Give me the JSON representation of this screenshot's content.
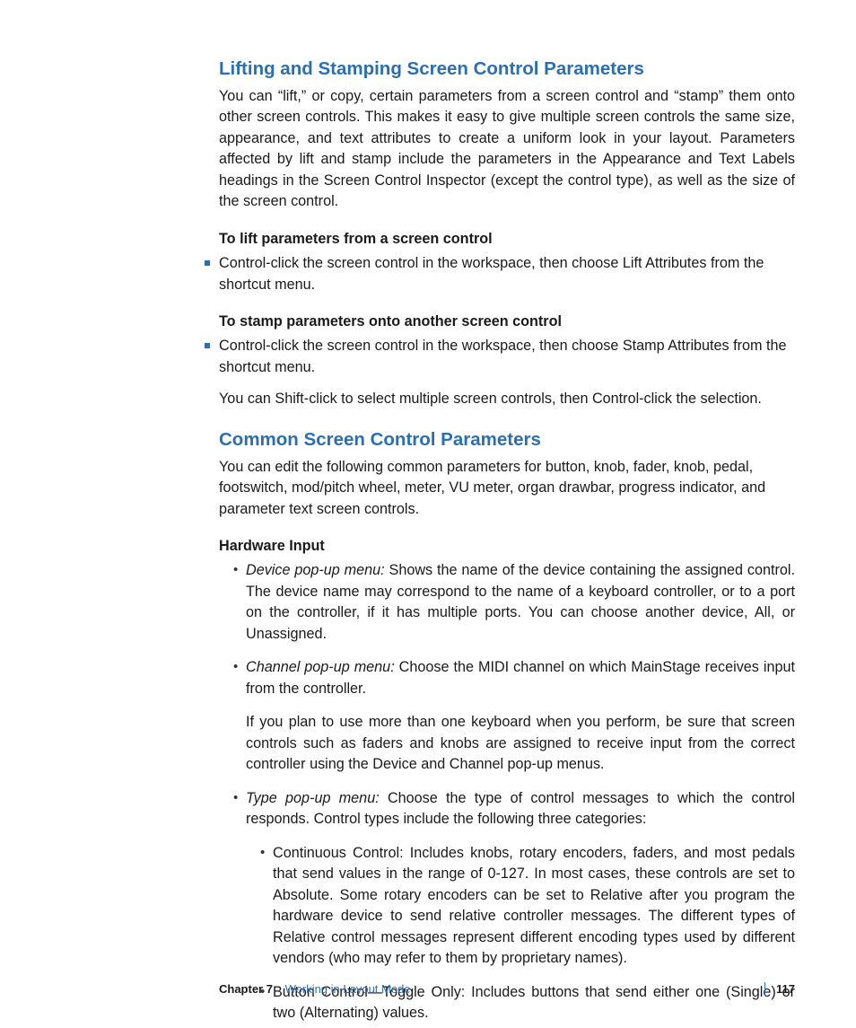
{
  "section1": {
    "heading": "Lifting and Stamping Screen Control Parameters",
    "intro": "You can “lift,” or copy, certain parameters from a screen control and “stamp” them onto other screen controls. This makes it easy to give multiple screen controls the same size, appearance, and text attributes to create a uniform look in your layout. Parameters affected by lift and stamp include the parameters in the Appearance and Text Labels headings in the Screen Control Inspector (except the control type), as well as the size of the screen control.",
    "sub1_title": "To lift parameters from a screen control",
    "sub1_item": "Control-click the screen control in the workspace, then choose Lift Attributes from the shortcut menu.",
    "sub2_title": "To stamp parameters onto another screen control",
    "sub2_item": "Control-click the screen control in the workspace, then choose Stamp Attributes from the shortcut menu.",
    "sub2_note": "You can Shift-click to select multiple screen controls, then Control-click the selection."
  },
  "section2": {
    "heading": "Common Screen Control Parameters",
    "intro": "You can edit the following common parameters for button, knob, fader, knob, pedal, footswitch, mod/pitch wheel, meter, VU meter, organ drawbar, progress indicator, and parameter text screen controls.",
    "hw_title": "Hardware Input",
    "items": [
      {
        "term": "Device pop-up menu:",
        "text": "  Shows the name of the device containing the assigned control. The device name may correspond to the name of a keyboard controller, or to a port on the controller, if it has multiple ports. You can choose another device, All, or Unassigned."
      },
      {
        "term": "Channel pop-up menu:",
        "text": "  Choose the MIDI channel on which MainStage receives input from the controller.",
        "extra": "If you plan to use more than one keyboard when you perform, be sure that screen controls such as faders and knobs are assigned to receive input from the correct controller using the Device and Channel pop-up menus."
      },
      {
        "term": "Type pop-up menu:",
        "text": "  Choose the type of control messages to which the control responds. Control types include the following three categories:",
        "subs": [
          "Continuous Control:  Includes knobs, rotary encoders, faders, and most pedals that send values in the range of 0-127. In most cases, these controls are set to Absolute. Some rotary encoders can be set to Relative after you program the hardware device to send relative controller messages. The different types of Relative control messages represent different encoding types used by different vendors (who may refer to them by proprietary names).",
          "Button Control—Toggle Only:  Includes buttons that send either one (Single) or two (Alternating) values."
        ]
      }
    ]
  },
  "footer": {
    "chapter": "Chapter 7",
    "title": "Working in Layout Mode",
    "page": "117"
  }
}
